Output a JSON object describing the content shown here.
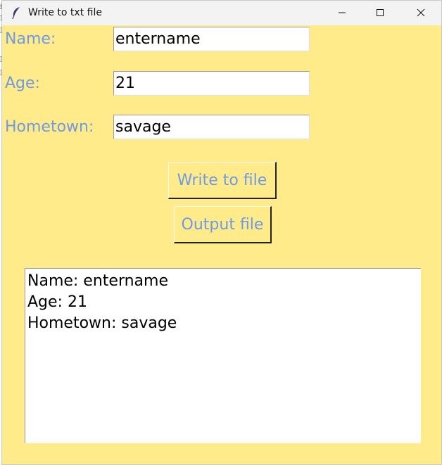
{
  "background_glyphs": [
    "f",
    "I",
    "I",
    "F",
    "I"
  ],
  "window": {
    "title": "Write to txt file",
    "app_icon": "feather-icon",
    "controls": {
      "minimize_icon": "minimize-icon",
      "maximize_icon": "maximize-icon",
      "close_icon": "close-icon"
    }
  },
  "form": {
    "name_label": "Name:",
    "name_value": "entername",
    "age_label": "Age:",
    "age_value": "21",
    "hometown_label": "Hometown:",
    "hometown_value": "savage"
  },
  "buttons": {
    "write_label": "Write to file",
    "output_label": "Output file"
  },
  "output_text": {
    "lines": [
      "Name: entername",
      "Age: 21",
      "Hometown: savage"
    ]
  },
  "colors": {
    "window_bg": "#ffeb8a",
    "label_color": "#6f9ae6"
  }
}
